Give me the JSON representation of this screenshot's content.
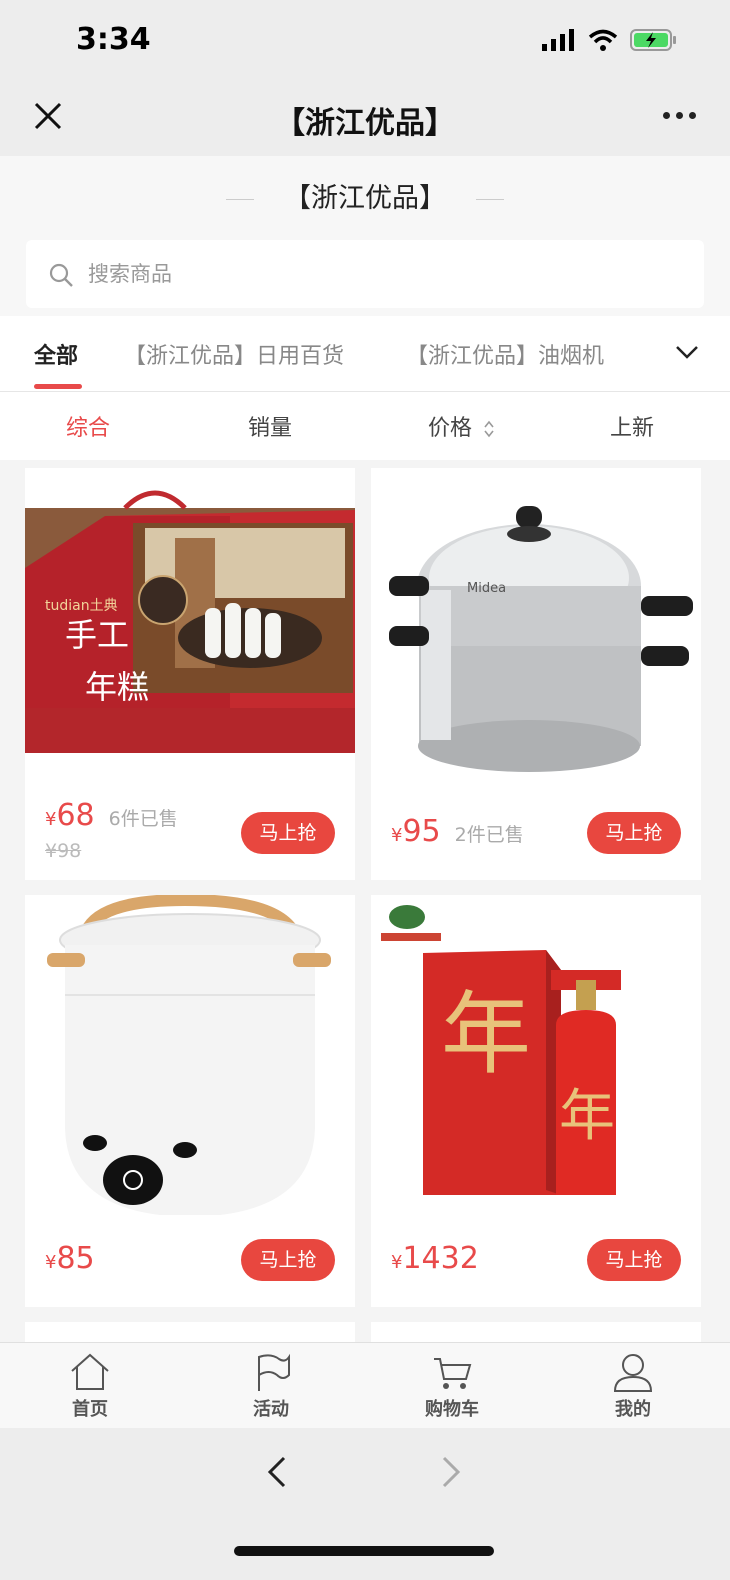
{
  "status": {
    "time": "3:34"
  },
  "nav": {
    "title": "【浙江优品】"
  },
  "shop": {
    "title": "【浙江优品】"
  },
  "search": {
    "placeholder": "搜索商品"
  },
  "categories": [
    {
      "label": "全部"
    },
    {
      "label": "【浙江优品】日用百货"
    },
    {
      "label": "【浙江优品】油烟机"
    }
  ],
  "sort": {
    "items": [
      {
        "label": "综合"
      },
      {
        "label": "销量"
      },
      {
        "label": "价格"
      },
      {
        "label": "上新"
      }
    ]
  },
  "products": [
    {
      "name_icon": "rice-cake-gift-box",
      "yen": "¥",
      "price": "68",
      "sold": "6件已售",
      "orig_price": "¥98",
      "buy": "马上抢"
    },
    {
      "name_icon": "steamer-pot",
      "yen": "¥",
      "price": "95",
      "sold": "2件已售",
      "buy": "马上抢"
    },
    {
      "name_icon": "rice-cooker",
      "yen": "¥",
      "price": "85",
      "buy": "马上抢"
    },
    {
      "name_icon": "liquor-gift-box",
      "yen": "¥",
      "price": "1432",
      "buy": "马上抢"
    }
  ],
  "tabbar": [
    {
      "label": "首页",
      "icon": "home-icon"
    },
    {
      "label": "活动",
      "icon": "flag-icon"
    },
    {
      "label": "购物车",
      "icon": "cart-icon"
    },
    {
      "label": "我的",
      "icon": "user-icon"
    }
  ],
  "colors": {
    "accent": "#e84a4a",
    "button": "#e8473f"
  }
}
